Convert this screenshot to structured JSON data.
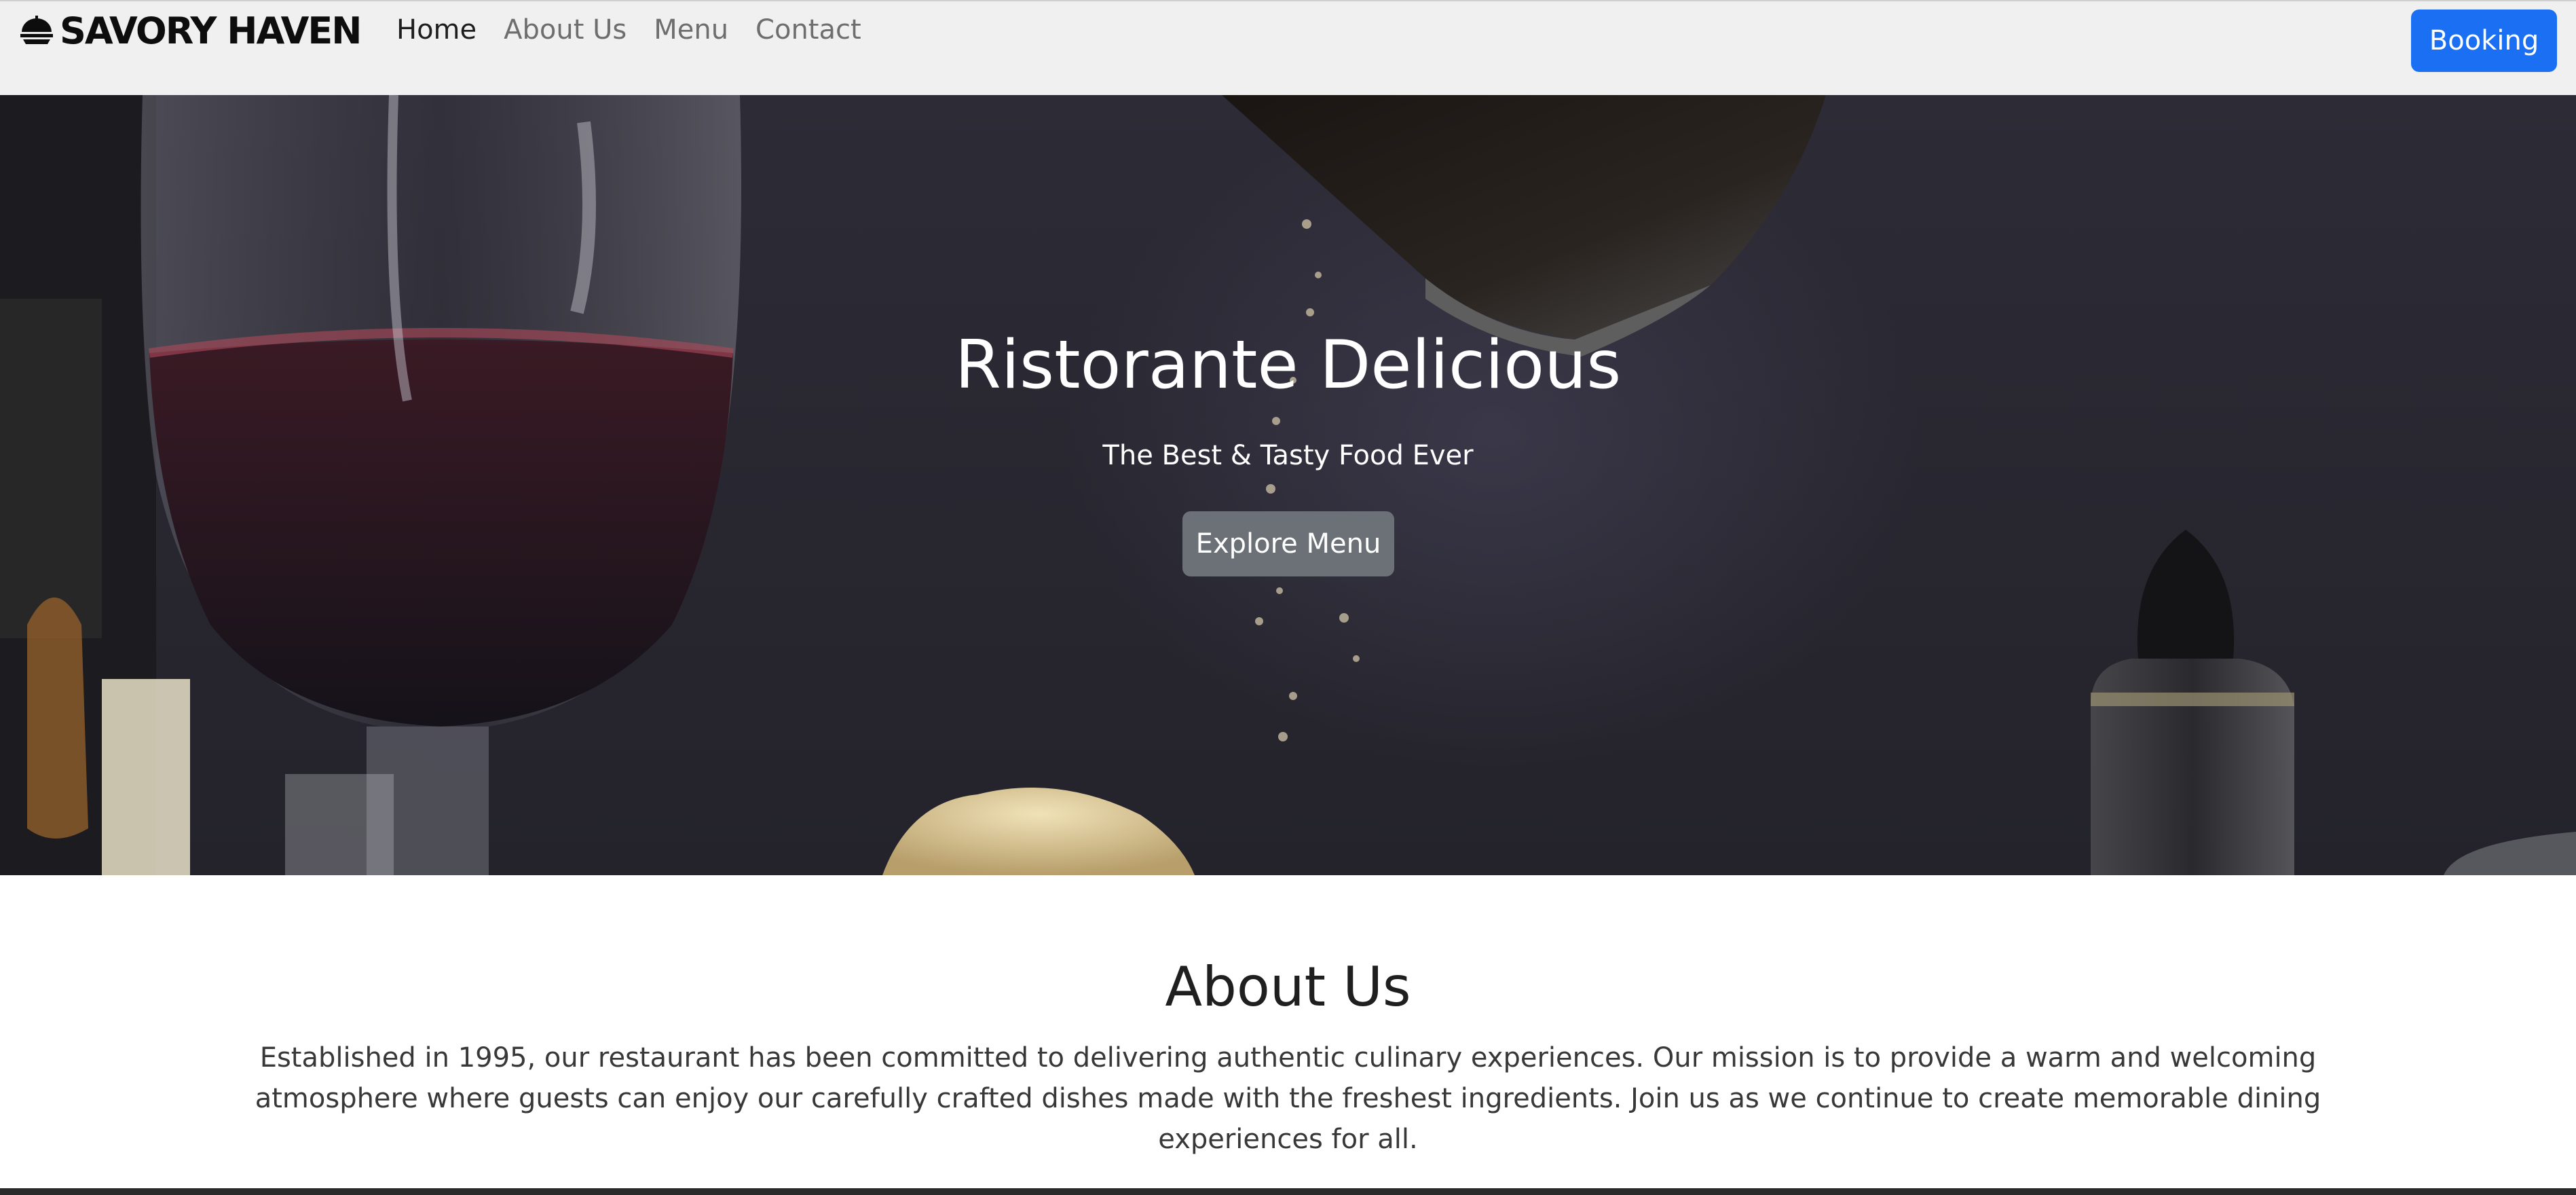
{
  "brand": {
    "name": "SAVORY HAVEN",
    "icon": "dish-cloche-icon"
  },
  "nav": {
    "items": [
      {
        "label": "Home",
        "active": true
      },
      {
        "label": "About Us",
        "active": false
      },
      {
        "label": "Menu",
        "active": false
      },
      {
        "label": "Contact",
        "active": false
      }
    ],
    "booking_label": "Booking"
  },
  "hero": {
    "title": "Ristorante Delicious",
    "subtitle": "The Best & Tasty Food Ever",
    "cta_label": "Explore Menu"
  },
  "about": {
    "title": "About Us",
    "text": "Established in 1995, our restaurant has been committed to delivering authentic culinary experiences. Our mission is to provide a warm and welcoming atmosphere where guests can enjoy our carefully crafted dishes made with the freshest ingredients. Join us as we continue to create memorable dining experiences for all."
  },
  "colors": {
    "navbar_bg": "#f0f0f0",
    "primary": "#1a6ff2",
    "secondary_button": "#6b7176",
    "hero_bg": "#2b2933"
  }
}
